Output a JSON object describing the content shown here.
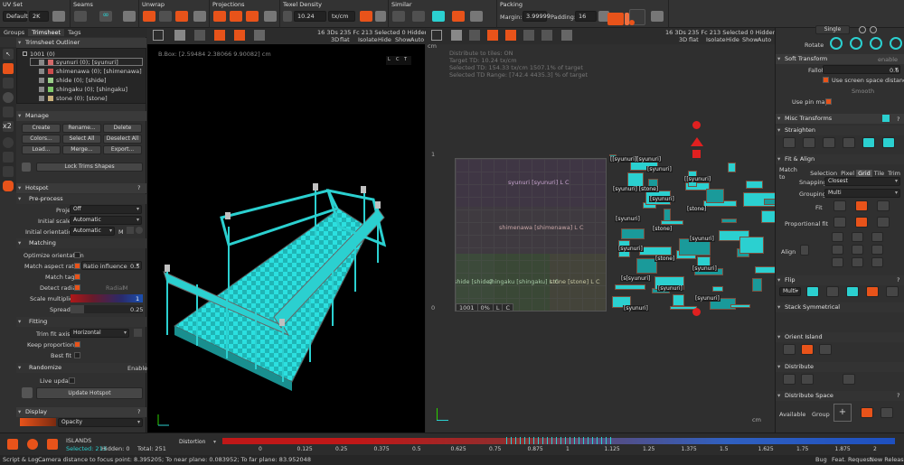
{
  "topbar": {
    "uvset": {
      "title": "UV Set",
      "value": "Default",
      "resolution": "2K"
    },
    "seams": {
      "title": "Seams"
    },
    "unwrap": {
      "title": "Unwrap"
    },
    "projections": {
      "title": "Projections"
    },
    "texel": {
      "title": "Texel Density",
      "value": "10.24",
      "unit": "tx/cm"
    },
    "similar": {
      "title": "Similar"
    },
    "packing": {
      "title": "Packing",
      "margin_label": "Margin:",
      "margin_value": "3.99999",
      "padding_label": "Padding:",
      "padding_value": "16"
    }
  },
  "left": {
    "tabs": [
      "Groups",
      "Trimsheet",
      "Tags"
    ],
    "outliner_title": "Trimsheet Outliner",
    "outliner_root": "1001 (0)",
    "outliner_items": [
      "syunuri (0); [syunuri]",
      "shimenawa (0); [shimenawa]",
      "shide (0); [shide]",
      "shingaku (0); [shingaku]",
      "stone (0); [stone]"
    ],
    "outliner_colors": [
      "#d46a6a",
      "#cc4d4d",
      "#9acd8a",
      "#7fc96a",
      "#c9b07a"
    ],
    "manage_title": "Manage",
    "manage_buttons": [
      [
        "Create",
        "Rename...",
        "Delete"
      ],
      [
        "Colors...",
        "Select All",
        "Deselect All"
      ],
      [
        "Load...",
        "Merge...",
        "Export..."
      ]
    ],
    "lock_trims": "Lock Trims Shapes",
    "hotspot_title": "Hotspot",
    "preprocess_title": "Pre-process",
    "projection_label": "Projection",
    "projection_value": "Off",
    "initial_scale_label": "Initial scale",
    "initial_scale_value": "Automatic",
    "initial_orient_label": "Initial orientation",
    "initial_orient_value": "Automatic",
    "initial_orient_extra": "M",
    "matching_title": "Matching",
    "optimize_orientation": "Optimize orientation",
    "match_aspect": "Match aspect ratio",
    "ratio_influence_label": "Ratio influence",
    "ratio_influence_value": "0.5",
    "match_tags": "Match tags",
    "detect_radial": "Detect radial",
    "radial_label": "Radial",
    "radial_value": "M",
    "scale_multiplier": "Scale multiplier",
    "scale_value": "1",
    "spread": "Spread",
    "spread_value": "0.25",
    "fitting_title": "Fitting",
    "trim_fit_axis": "Trim fit axis",
    "trim_fit_value": "Horizontal",
    "keep_proportions": "Keep proportions",
    "best_fit": "Best fit",
    "randomize": "Randomize",
    "randomize_enable": "Enable",
    "live_update": "Live update",
    "update_hotspot": "Update Hotspot",
    "display_title": "Display",
    "opacity": "Opacity"
  },
  "vp3d": {
    "stats": "16 3Ds 235 Fc   213 Selected   0 Hidden",
    "modes": [
      "3D",
      "flat",
      "Isolate",
      "Hide",
      "Show",
      "Auto"
    ],
    "bbox": "B.Box: [2.59484 2.38066 9.90082] cm",
    "axis_labels": [
      "L",
      "C",
      "T"
    ]
  },
  "vpuv": {
    "stats": "16 3Ds 235 Fc   213 Selected   0 Hidden",
    "modes": [
      "3D",
      "flat",
      "Isolate",
      "Hide",
      "Show",
      "Auto"
    ],
    "info": [
      "Distribute to tiles: ON",
      "Target TD: 10.24 tx/cm",
      "Selected TD: 154.33 tx/cm 1507.1% of target",
      "Selected TD Range: [742.4   4435.3] % of target"
    ],
    "cm_left": "cm",
    "cm_bottom": "cm",
    "axis_1": "1",
    "axis_0": "0",
    "tile": "1001",
    "tile_pct": "0%",
    "trims": [
      {
        "text": "syunuri  [syunuri]  L  C"
      },
      {
        "text": "shimenawa  [shimenawa]  L  C"
      },
      {
        "text": "shide  [shide]"
      },
      {
        "text": "shingaku  [shingaku]  L  C"
      },
      {
        "text": "stone  [stone]  L  C"
      }
    ],
    "island_label": "[syunuri]",
    "island_labels": [
      "[[syunuri][syunuri]",
      "[syunuri]",
      "[[syunuri]",
      "[syunuri] [stone]",
      "[syunuri]",
      "[stone]",
      "[syunuri]",
      "[stone]",
      "[syunuri]",
      "[syunuri]",
      "[stone]",
      "[syunuri]",
      "[s[syunuri]",
      "[syunuri]",
      "[syunuri]",
      "[syunuri]"
    ]
  },
  "right": {
    "single_label": "Single",
    "rotate": "Rotate",
    "soft_transform": "Soft Transform",
    "soft_enable": "enable",
    "falloff": "Falloff",
    "falloff_value": "0.6",
    "use_screen_space": "Use screen space distance",
    "smooth": "Smooth",
    "use_pin_map": "Use pin map",
    "misc_transforms": "Misc Transforms",
    "straighten": "Straighten",
    "fit_align": "Fit & Align",
    "match_to": "Match to",
    "match_opts": [
      "Selection",
      "Pixel",
      "Grid",
      "Tile",
      "Trim"
    ],
    "snapping": "Snapping",
    "snapping_value": "Closest",
    "grouping": "Grouping",
    "grouping_value": "Multi",
    "fit": "Fit",
    "proportional_fit": "Proportional fit",
    "align": "Align",
    "flip": "Flip",
    "flip_value": "Multi",
    "stack_symmetrical": "Stack Symmetrical",
    "orient_island": "Orient Island",
    "distribute": "Distribute",
    "distribute_space": "Distribute Space",
    "available": "Available",
    "group": "Group"
  },
  "bottom": {
    "islands_title": "ISLANDS",
    "selected": "Selected: 213",
    "hidden": "Hidden: 0",
    "total": "Total: 251",
    "distortion": "Distortion",
    "ticks": [
      "0",
      "0.125",
      "0.25",
      "0.375",
      "0.5",
      "0.625",
      "0.75",
      "0.875",
      "1",
      "1.125",
      "1.25",
      "1.375",
      "1.5",
      "1.625",
      "1.75",
      "1.875",
      "2"
    ]
  },
  "status": {
    "left": "Script & Log...",
    "camera": "Camera distance to focus point: 8.395205; To near plane: 0.083952; To far plane: 83.952048",
    "links": [
      "Bug",
      "Feat. Request",
      "New Release"
    ]
  },
  "colors": {
    "accent": "#e8531a",
    "cyan": "#2bd0d0",
    "panel": "#303030"
  }
}
